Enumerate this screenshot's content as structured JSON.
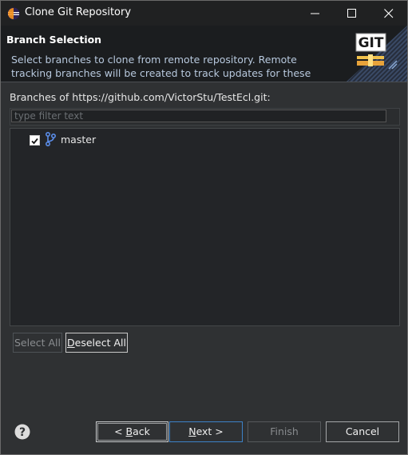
{
  "window": {
    "title": "Clone Git Repository"
  },
  "banner": {
    "title": "Branch Selection",
    "description": "Select branches to clone from remote repository. Remote tracking branches will be created to track updates for these branches in the",
    "logo_text": "GIT"
  },
  "branches": {
    "label": "Branches of https://github.com/VictorStu/TestEcl.git:",
    "filter_placeholder": "type filter text",
    "filter_value": "",
    "items": [
      {
        "name": "master",
        "checked": true
      }
    ]
  },
  "selection_buttons": {
    "select_all": "Select All",
    "deselect_all_rest": "eselect All",
    "deselect_all_mnemonic": "D"
  },
  "nav": {
    "back_prefix": "< ",
    "back_mnemonic": "B",
    "back_rest": "ack",
    "next_mnemonic": "N",
    "next_rest": "ext >",
    "finish": "Finish",
    "cancel": "Cancel"
  },
  "colors": {
    "accent": "#3d82c7",
    "branch_icon": "#5b8de8"
  }
}
